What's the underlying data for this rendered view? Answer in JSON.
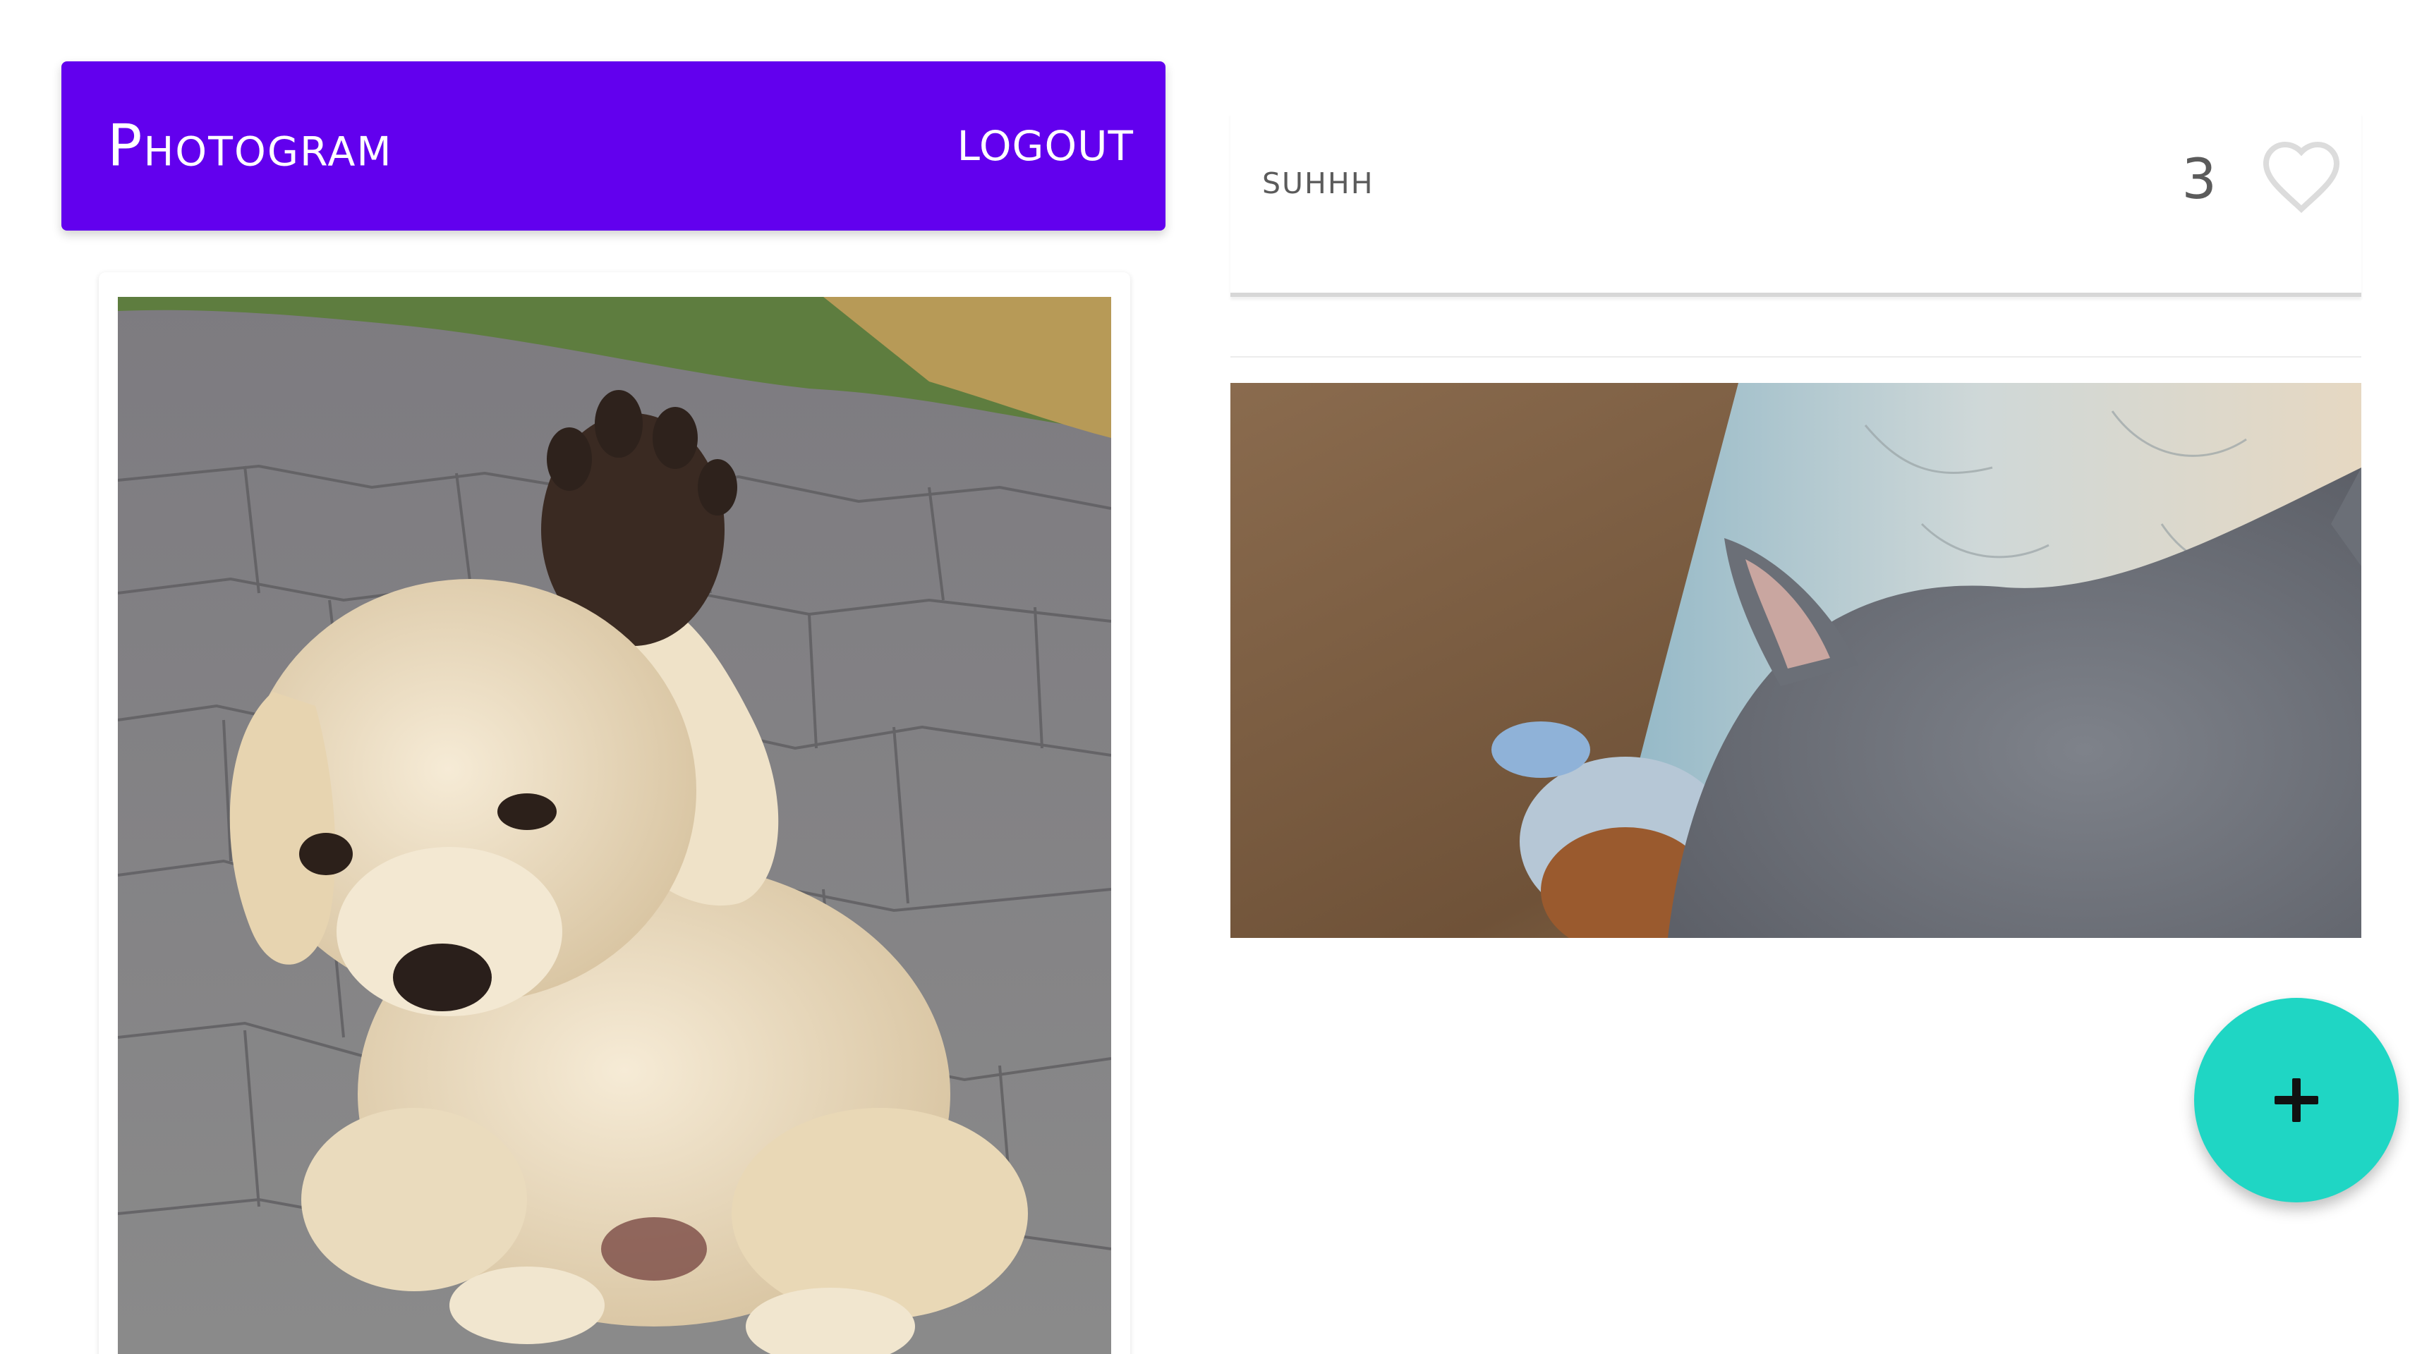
{
  "colors": {
    "accent": "#6200ee",
    "fab": "#1fd6c4",
    "text_muted": "#5b5b5b"
  },
  "app_bar": {
    "title": "Photogram",
    "logout_label": "LOGOUT"
  },
  "left_post": {
    "image": "puppy-photo"
  },
  "right_post": {
    "username": "suhhh",
    "like_count": "3",
    "like_icon": "heart-outline-icon",
    "image": "cat-photo"
  },
  "fab": {
    "icon": "plus-icon"
  }
}
